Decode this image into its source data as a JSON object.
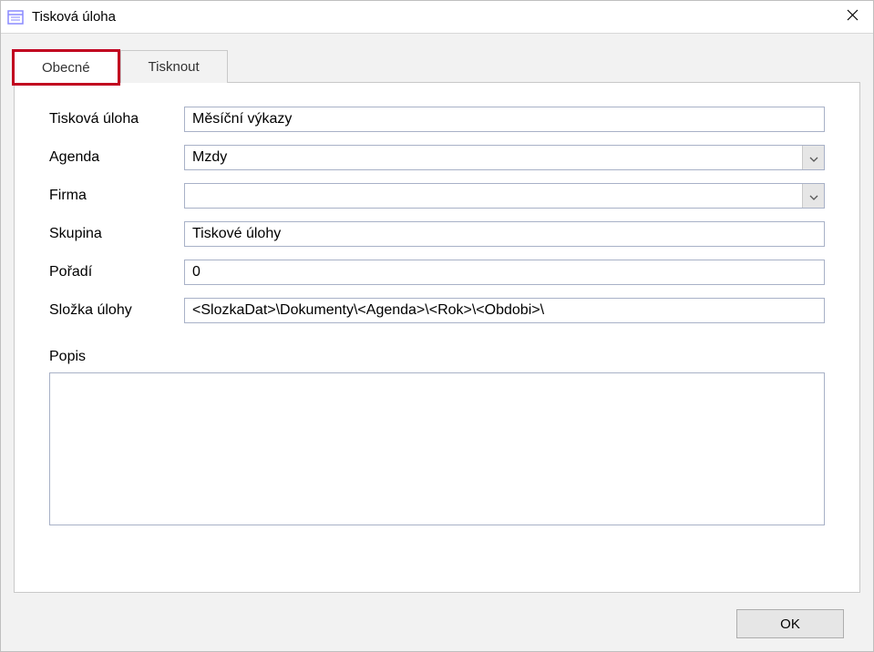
{
  "window": {
    "title": "Tisková úloha"
  },
  "tabs": {
    "general": "Obecné",
    "print": "Tisknout"
  },
  "form": {
    "taskLabel": "Tisková úloha",
    "taskValue": "Měsíční výkazy",
    "agendaLabel": "Agenda",
    "agendaValue": "Mzdy",
    "companyLabel": "Firma",
    "companyValue": "",
    "groupLabel": "Skupina",
    "groupValue": "Tiskové úlohy",
    "orderLabel": "Pořadí",
    "orderValue": "0",
    "folderLabel": "Složka úlohy",
    "folderValue": "<SlozkaDat>\\Dokumenty\\<Agenda>\\<Rok>\\<Obdobi>\\",
    "descLabel": "Popis",
    "descValue": ""
  },
  "buttons": {
    "ok": "OK"
  }
}
